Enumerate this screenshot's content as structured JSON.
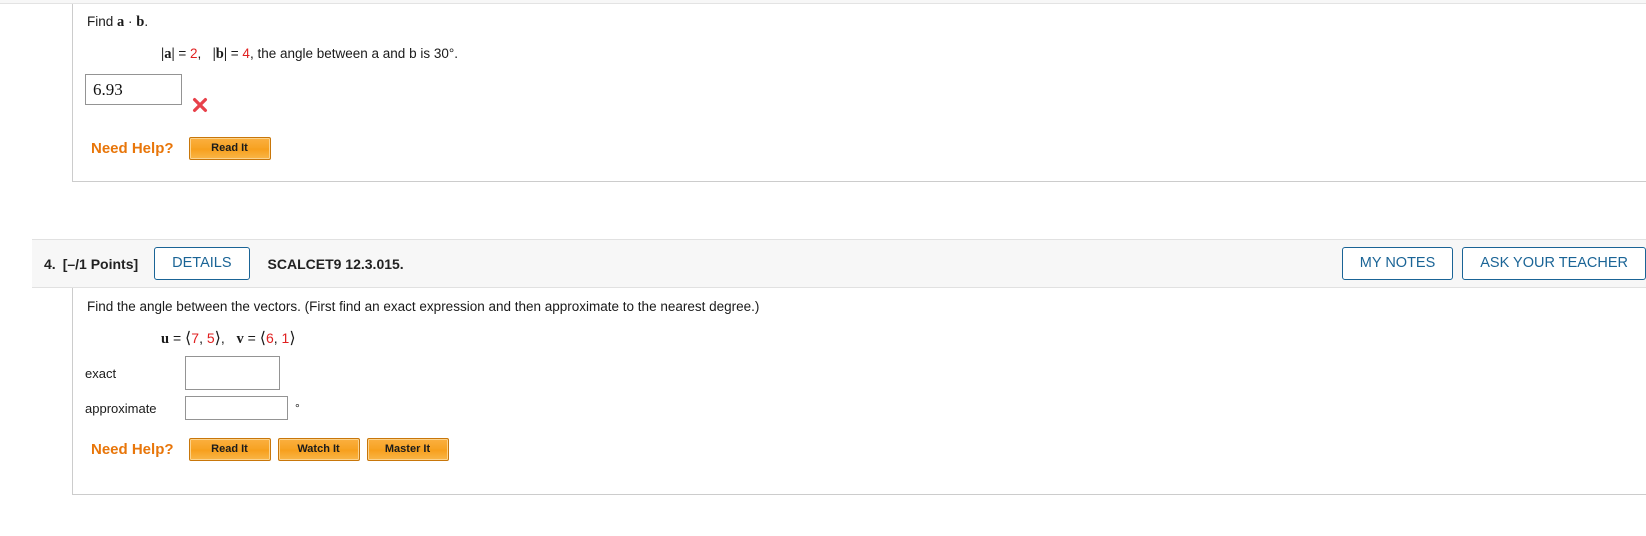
{
  "question3": {
    "prompt_prefix": "Find ",
    "prompt_a": "a",
    "prompt_dot": " · ",
    "prompt_b": "b",
    "prompt_suffix": ".",
    "given": {
      "abs_a_label": "|a|",
      "equals": " = ",
      "a_value": "2",
      "comma": ",",
      "abs_b_label": "|b|",
      "b_value": "4",
      "tail": ", the angle between a and b is 30°."
    },
    "answer_value": "6.93",
    "grade_icon": "red-x-icon",
    "grade_status": "incorrect",
    "need_help_label": "Need Help?",
    "help_buttons": [
      {
        "label": "Read It",
        "name": "read-it-button"
      }
    ]
  },
  "question4": {
    "number": "4.",
    "points": "[–/1 Points]",
    "details_label": "DETAILS",
    "textbook_ref": "SCALCET9 12.3.015.",
    "my_notes_label": "MY NOTES",
    "ask_teacher_label": "ASK YOUR TEACHER",
    "prompt": "Find the angle between the vectors. (First find an exact expression and then approximate to the nearest degree.)",
    "vectors": {
      "u_name": "u",
      "v_name": "v",
      "equals": " = ",
      "u_x": "7",
      "u_y": "5",
      "v_x": "6",
      "v_y": "1",
      "open_bracket": "⟨",
      "close_bracket": "⟩",
      "comma_sep": ", ",
      "between": ",   "
    },
    "fields": [
      {
        "label": "exact",
        "value": "",
        "name": "exact-answer-input"
      },
      {
        "label": "approximate",
        "value": "",
        "name": "approximate-answer-input"
      }
    ],
    "degree_symbol": "°",
    "need_help_label": "Need Help?",
    "help_buttons": [
      {
        "label": "Read It",
        "name": "read-it-button"
      },
      {
        "label": "Watch It",
        "name": "watch-it-button"
      },
      {
        "label": "Master It",
        "name": "master-it-button"
      }
    ]
  },
  "colors": {
    "accent_blue": "#1a6496",
    "help_orange": "#e8760a",
    "value_red": "#e02020",
    "incorrect_red": "#e8414a",
    "header_bg": "#f7f7f7",
    "border_gray": "#cccccc"
  }
}
